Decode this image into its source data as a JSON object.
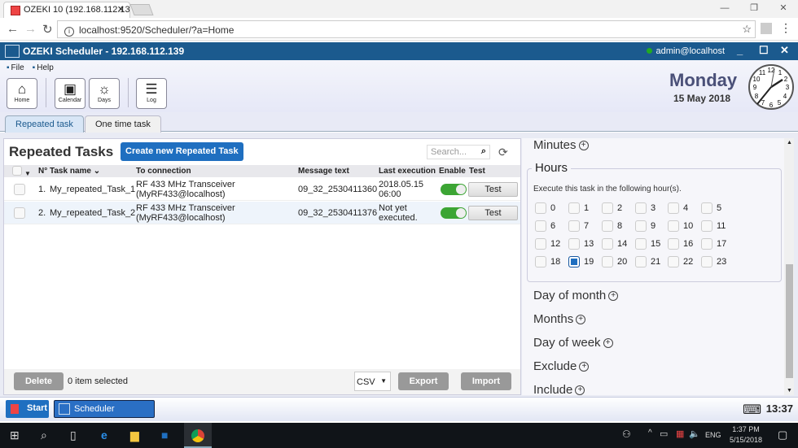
{
  "browser": {
    "tab_title": "OZEKI 10 (192.168.112.139)",
    "url": "localhost:9520/Scheduler/?a=Home"
  },
  "app": {
    "title": "OZEKI Scheduler - 192.168.112.139",
    "user": "admin@localhost",
    "menu": [
      "File",
      "Help"
    ],
    "toolbar": [
      {
        "label": "Home",
        "icon": "home-icon"
      },
      {
        "label": "Calendar",
        "icon": "calendar-icon"
      },
      {
        "label": "Days",
        "icon": "sun-icon"
      },
      {
        "label": "Log",
        "icon": "document-icon"
      }
    ],
    "day": "Monday",
    "date": "15 May 2018",
    "clock_time": "13:37"
  },
  "tabs": [
    {
      "label": "Repeated task",
      "active": true
    },
    {
      "label": "One time task",
      "active": false
    }
  ],
  "tasks": {
    "title": "Repeated Tasks",
    "create_label": "Create new Repeated Task",
    "search_placeholder": "Search...",
    "columns": [
      "N°",
      "Task name",
      "To connection",
      "Message text",
      "Last execution",
      "Enable",
      "Test"
    ],
    "rows": [
      {
        "n": "1.",
        "name": "My_repeated_Task_1",
        "conn1": "RF 433 MHz Transceiver",
        "conn2": "(MyRF433@localhost)",
        "msg": "09_32_2530411360",
        "last1": "2018.05.15",
        "last2": "06:00",
        "enabled": true,
        "test": "Test"
      },
      {
        "n": "2.",
        "name": "My_repeated_Task_2",
        "conn1": "RF 433 MHz Transceiver",
        "conn2": "(MyRF433@localhost)",
        "msg": "09_32_2530411376",
        "last1": "Not yet",
        "last2": "executed.",
        "enabled": true,
        "test": "Test"
      }
    ],
    "delete_label": "Delete",
    "selected": "0 item selected",
    "format": "CSV",
    "export_label": "Export",
    "import_label": "Import"
  },
  "schedule": {
    "minutes": "Minutes",
    "hours_title": "Hours",
    "hours_desc": "Execute this task in the following hour(s).",
    "hours": [
      "0",
      "1",
      "2",
      "3",
      "4",
      "5",
      "6",
      "7",
      "8",
      "9",
      "10",
      "11",
      "12",
      "13",
      "14",
      "15",
      "16",
      "17",
      "18",
      "19",
      "20",
      "21",
      "22",
      "23"
    ],
    "selected_hours": [
      "19"
    ],
    "sections": [
      "Day of month",
      "Months",
      "Day of week",
      "Exclude",
      "Include"
    ]
  },
  "taskbar": {
    "start": "Start",
    "app": "Scheduler",
    "time": "13:37"
  },
  "windows": {
    "time": "1:37 PM",
    "date": "5/15/2018",
    "lang": "ENG"
  }
}
